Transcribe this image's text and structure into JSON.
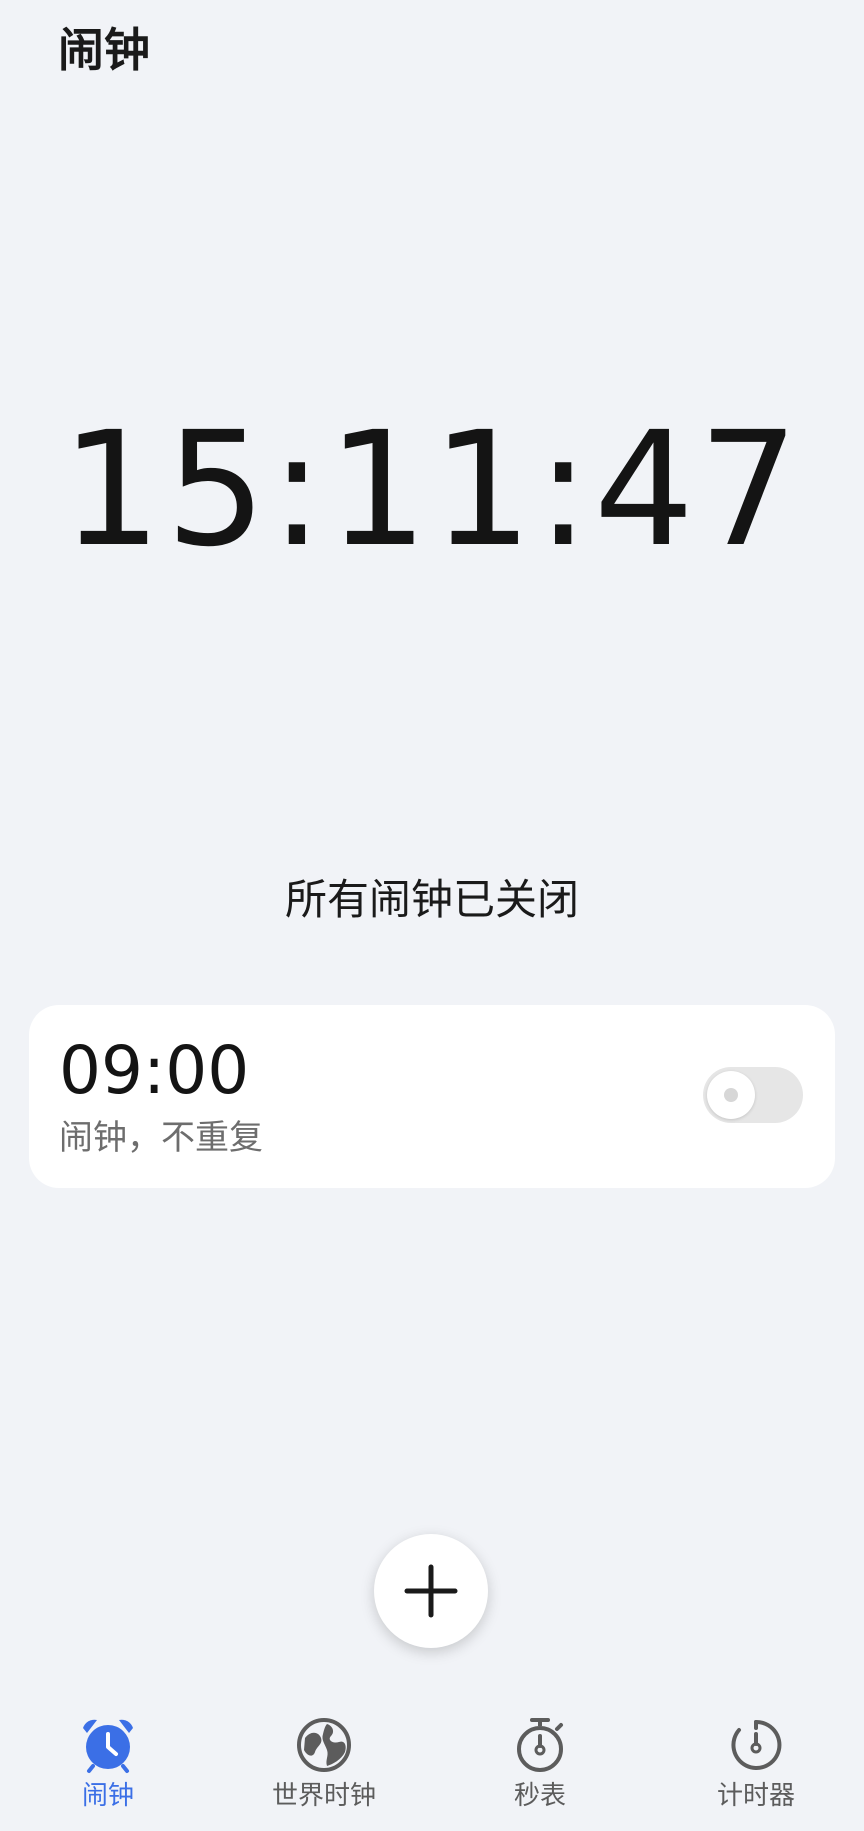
{
  "header": {
    "title": "闹钟"
  },
  "clock": {
    "current_time": "15:11:47"
  },
  "status": {
    "text": "所有闹钟已关闭"
  },
  "alarms": [
    {
      "time": "09:00",
      "subtitle": "闹钟，不重复",
      "enabled": false
    }
  ],
  "fab": {
    "icon": "plus-icon"
  },
  "bottom_nav": {
    "accent_color": "#3b6fe6",
    "items": [
      {
        "label": "闹钟",
        "icon": "alarm-clock-icon",
        "active": true
      },
      {
        "label": "世界时钟",
        "icon": "globe-icon",
        "active": false
      },
      {
        "label": "秒表",
        "icon": "stopwatch-icon",
        "active": false
      },
      {
        "label": "计时器",
        "icon": "timer-icon",
        "active": false
      }
    ]
  }
}
